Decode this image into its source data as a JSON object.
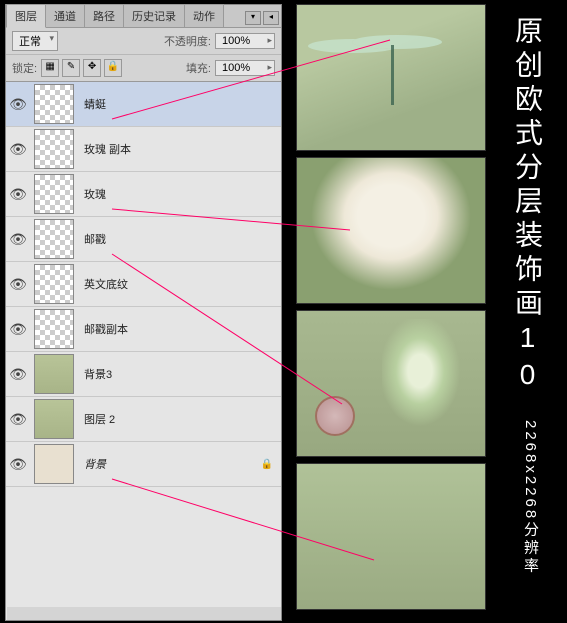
{
  "panel": {
    "tabs": [
      "图层",
      "通道",
      "路径",
      "历史记录",
      "动作"
    ],
    "activeTab": 0,
    "blendMode": "正常",
    "opacityLabel": "不透明度:",
    "opacityValue": "100%",
    "lockLabel": "锁定:",
    "fillLabel": "填充:",
    "fillValue": "100%"
  },
  "layers": [
    {
      "name": "蜻蜓",
      "vis": true,
      "thumb": "checker",
      "sel": true
    },
    {
      "name": "玫瑰 副本",
      "vis": true,
      "thumb": "checker"
    },
    {
      "name": "玫瑰",
      "vis": true,
      "thumb": "checker"
    },
    {
      "name": "邮戳",
      "vis": true,
      "thumb": "checker"
    },
    {
      "name": "英文底纹",
      "vis": true,
      "thumb": "checker"
    },
    {
      "name": "邮戳副本",
      "vis": true,
      "thumb": "checker"
    },
    {
      "name": "背景3",
      "vis": true,
      "thumb": "green"
    },
    {
      "name": "图层 2",
      "vis": true,
      "thumb": "green"
    },
    {
      "name": "背景",
      "vis": true,
      "thumb": "paper",
      "locked": true,
      "italic": true
    }
  ],
  "title": "原创欧式分层装饰画10",
  "subtitle": "2268x2268分辨率"
}
